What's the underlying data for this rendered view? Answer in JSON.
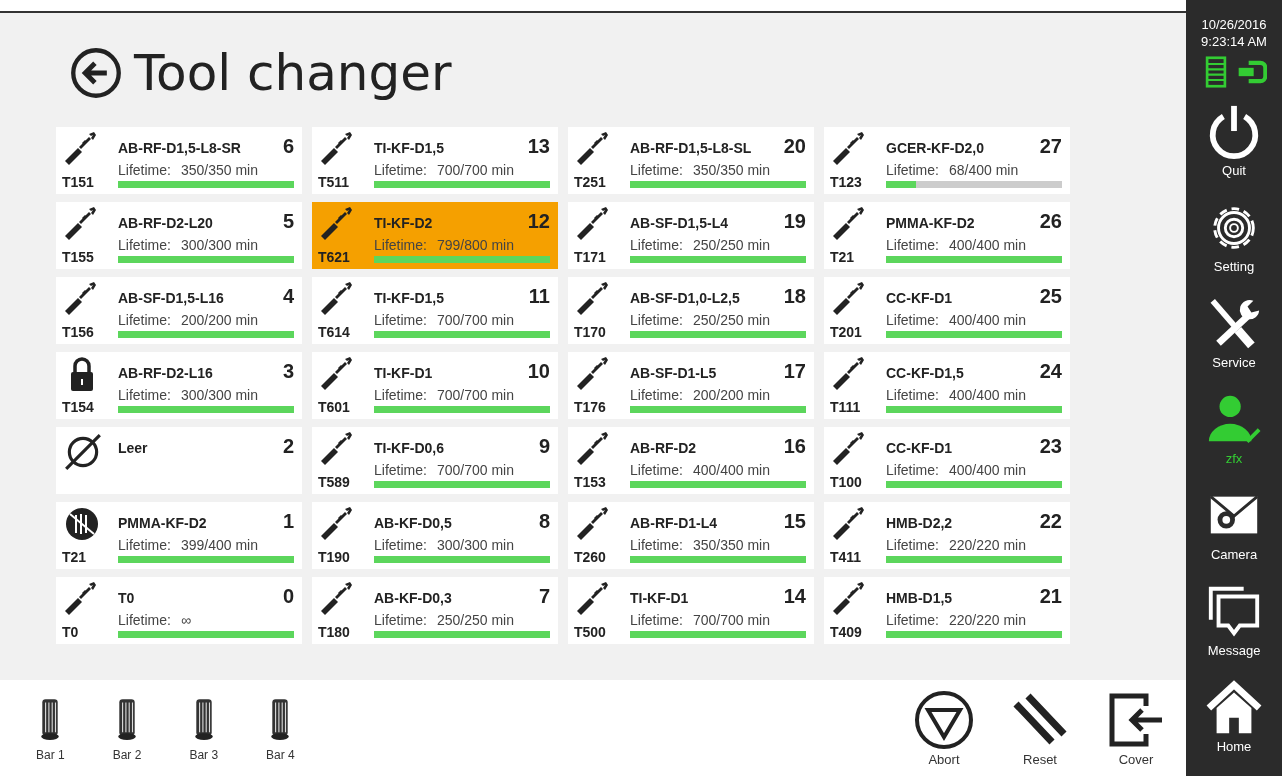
{
  "header": {
    "title": "Tool changer"
  },
  "cards": [
    {
      "kind": "tool",
      "name": "AB-RF-D1,5-L8-SR",
      "slot": "6",
      "tool": "T151",
      "lifetime_label": "Lifetime:",
      "lifetime": "350/350 min",
      "level": 1,
      "selected": false
    },
    {
      "kind": "tool",
      "name": "TI-KF-D1,5",
      "slot": "13",
      "tool": "T511",
      "lifetime_label": "Lifetime:",
      "lifetime": "700/700 min",
      "level": 1,
      "selected": false
    },
    {
      "kind": "tool",
      "name": "AB-RF-D1,5-L8-SL",
      "slot": "20",
      "tool": "T251",
      "lifetime_label": "Lifetime:",
      "lifetime": "350/350 min",
      "level": 1,
      "selected": false
    },
    {
      "kind": "tool",
      "name": "GCER-KF-D2,0",
      "slot": "27",
      "tool": "T123",
      "lifetime_label": "Lifetime:",
      "lifetime": "68/400 min",
      "level": 0.17,
      "selected": false
    },
    {
      "kind": "tool",
      "name": "AB-RF-D2-L20",
      "slot": "5",
      "tool": "T155",
      "lifetime_label": "Lifetime:",
      "lifetime": "300/300 min",
      "level": 1,
      "selected": false
    },
    {
      "kind": "tool",
      "name": "TI-KF-D2",
      "slot": "12",
      "tool": "T621",
      "lifetime_label": "Lifetime:",
      "lifetime": "799/800 min",
      "level": 0.999,
      "selected": true
    },
    {
      "kind": "tool",
      "name": "AB-SF-D1,5-L4",
      "slot": "19",
      "tool": "T171",
      "lifetime_label": "Lifetime:",
      "lifetime": "250/250 min",
      "level": 1,
      "selected": false
    },
    {
      "kind": "tool",
      "name": "PMMA-KF-D2",
      "slot": "26",
      "tool": "T21",
      "lifetime_label": "Lifetime:",
      "lifetime": "400/400 min",
      "level": 1,
      "selected": false
    },
    {
      "kind": "tool",
      "name": "AB-SF-D1,5-L16",
      "slot": "4",
      "tool": "T156",
      "lifetime_label": "Lifetime:",
      "lifetime": "200/200 min",
      "level": 1,
      "selected": false
    },
    {
      "kind": "tool",
      "name": "TI-KF-D1,5",
      "slot": "11",
      "tool": "T614",
      "lifetime_label": "Lifetime:",
      "lifetime": "700/700 min",
      "level": 1,
      "selected": false
    },
    {
      "kind": "tool",
      "name": "AB-SF-D1,0-L2,5",
      "slot": "18",
      "tool": "T170",
      "lifetime_label": "Lifetime:",
      "lifetime": "250/250 min",
      "level": 1,
      "selected": false
    },
    {
      "kind": "tool",
      "name": "CC-KF-D1",
      "slot": "25",
      "tool": "T201",
      "lifetime_label": "Lifetime:",
      "lifetime": "400/400 min",
      "level": 1,
      "selected": false
    },
    {
      "kind": "locked",
      "name": "AB-RF-D2-L16",
      "slot": "3",
      "tool": "T154",
      "lifetime_label": "Lifetime:",
      "lifetime": "300/300 min",
      "level": 1,
      "selected": false
    },
    {
      "kind": "tool",
      "name": "TI-KF-D1",
      "slot": "10",
      "tool": "T601",
      "lifetime_label": "Lifetime:",
      "lifetime": "700/700 min",
      "level": 1,
      "selected": false
    },
    {
      "kind": "tool",
      "name": "AB-SF-D1-L5",
      "slot": "17",
      "tool": "T176",
      "lifetime_label": "Lifetime:",
      "lifetime": "200/200 min",
      "level": 1,
      "selected": false
    },
    {
      "kind": "tool",
      "name": "CC-KF-D1,5",
      "slot": "24",
      "tool": "T111",
      "lifetime_label": "Lifetime:",
      "lifetime": "400/400 min",
      "level": 1,
      "selected": false
    },
    {
      "kind": "empty",
      "name": "Leer",
      "slot": "2",
      "selected": false
    },
    {
      "kind": "tool",
      "name": "TI-KF-D0,6",
      "slot": "9",
      "tool": "T589",
      "lifetime_label": "Lifetime:",
      "lifetime": "700/700 min",
      "level": 1,
      "selected": false
    },
    {
      "kind": "tool",
      "name": "AB-RF-D2",
      "slot": "16",
      "tool": "T153",
      "lifetime_label": "Lifetime:",
      "lifetime": "400/400 min",
      "level": 1,
      "selected": false
    },
    {
      "kind": "tool",
      "name": "CC-KF-D1",
      "slot": "23",
      "tool": "T100",
      "lifetime_label": "Lifetime:",
      "lifetime": "400/400 min",
      "level": 1,
      "selected": false
    },
    {
      "kind": "blocked",
      "name": "PMMA-KF-D2",
      "slot": "1",
      "tool": "T21",
      "lifetime_label": "Lifetime:",
      "lifetime": "399/400 min",
      "level": 0.998,
      "selected": false
    },
    {
      "kind": "tool",
      "name": "AB-KF-D0,5",
      "slot": "8",
      "tool": "T190",
      "lifetime_label": "Lifetime:",
      "lifetime": "300/300 min",
      "level": 1,
      "selected": false
    },
    {
      "kind": "tool",
      "name": "AB-RF-D1-L4",
      "slot": "15",
      "tool": "T260",
      "lifetime_label": "Lifetime:",
      "lifetime": "350/350 min",
      "level": 1,
      "selected": false
    },
    {
      "kind": "tool",
      "name": "HMB-D2,2",
      "slot": "22",
      "tool": "T411",
      "lifetime_label": "Lifetime:",
      "lifetime": "220/220 min",
      "level": 1,
      "selected": false
    },
    {
      "kind": "tool",
      "name": "T0",
      "slot": "0",
      "tool": "T0",
      "lifetime_label": "Lifetime:",
      "lifetime": "∞",
      "level": 1,
      "selected": false
    },
    {
      "kind": "tool",
      "name": "AB-KF-D0,3",
      "slot": "7",
      "tool": "T180",
      "lifetime_label": "Lifetime:",
      "lifetime": "250/250 min",
      "level": 1,
      "selected": false
    },
    {
      "kind": "tool",
      "name": "TI-KF-D1",
      "slot": "14",
      "tool": "T500",
      "lifetime_label": "Lifetime:",
      "lifetime": "700/700 min",
      "level": 1,
      "selected": false
    },
    {
      "kind": "tool",
      "name": "HMB-D1,5",
      "slot": "21",
      "tool": "T409",
      "lifetime_label": "Lifetime:",
      "lifetime": "220/220 min",
      "level": 1,
      "selected": false
    }
  ],
  "bars": [
    {
      "label": "Bar 1"
    },
    {
      "label": "Bar 2"
    },
    {
      "label": "Bar 3"
    },
    {
      "label": "Bar 4"
    }
  ],
  "actions": [
    {
      "kind": "abort",
      "label": "Abort"
    },
    {
      "kind": "reset",
      "label": "Reset"
    },
    {
      "kind": "cover",
      "label": "Cover"
    }
  ],
  "sidebar": {
    "date": "10/26/2016",
    "time": "9:23:14 AM",
    "items": [
      {
        "kind": "quit",
        "label": "Quit",
        "active": false
      },
      {
        "kind": "setting",
        "label": "Setting",
        "active": false
      },
      {
        "kind": "service",
        "label": "Service",
        "active": false
      },
      {
        "kind": "user",
        "label": "zfx",
        "active": true
      },
      {
        "kind": "camera",
        "label": "Camera",
        "active": false
      },
      {
        "kind": "message",
        "label": "Message",
        "active": false
      },
      {
        "kind": "home",
        "label": "Home",
        "active": false
      }
    ]
  }
}
